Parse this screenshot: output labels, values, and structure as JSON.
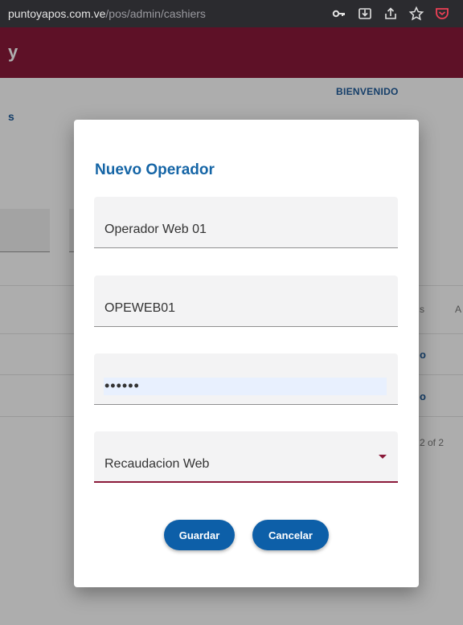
{
  "browser": {
    "url_host": "puntoyapos.com.ve",
    "url_path": "/pos/admin/cashiers",
    "icons": [
      "key-icon",
      "install-icon",
      "share-icon",
      "star-icon",
      "pocket-icon"
    ]
  },
  "header": {
    "logo_fragment": "y",
    "color": "#8b1a3a"
  },
  "page": {
    "welcome": "BIENVENIDO",
    "tab_fragment": "s",
    "table": {
      "header_fragments": [
        "s",
        "A"
      ],
      "row_links": [
        "o",
        "o"
      ],
      "pagination": "2 of 2"
    }
  },
  "dialog": {
    "title": "Nuevo Operador",
    "fields": {
      "name_value": "Operador Web 01",
      "username_value": "OPEWEB01",
      "password_value": "••••••",
      "group_value": "Recaudacion Web"
    },
    "buttons": {
      "save": "Guardar",
      "cancel": "Cancelar"
    }
  },
  "colors": {
    "accent": "#8b1a3a",
    "primary": "#0d5fa8",
    "title": "#1565a6"
  }
}
